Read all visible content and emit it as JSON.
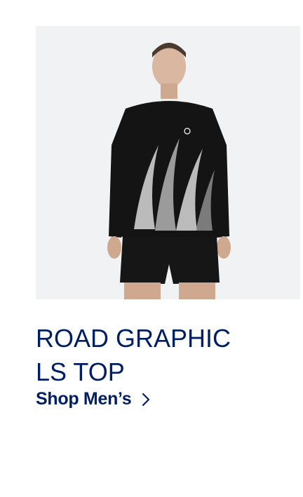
{
  "product": {
    "image_alt": "Man wearing black long sleeve running top with white flame graphic and black shorts",
    "title": "ROAD GRAPHIC LS TOP"
  },
  "cta": {
    "label": "Shop Men’s",
    "icon": "chevron-right-icon"
  },
  "colors": {
    "brand_navy": "#001e62",
    "image_bg": "#f1f2f4"
  }
}
